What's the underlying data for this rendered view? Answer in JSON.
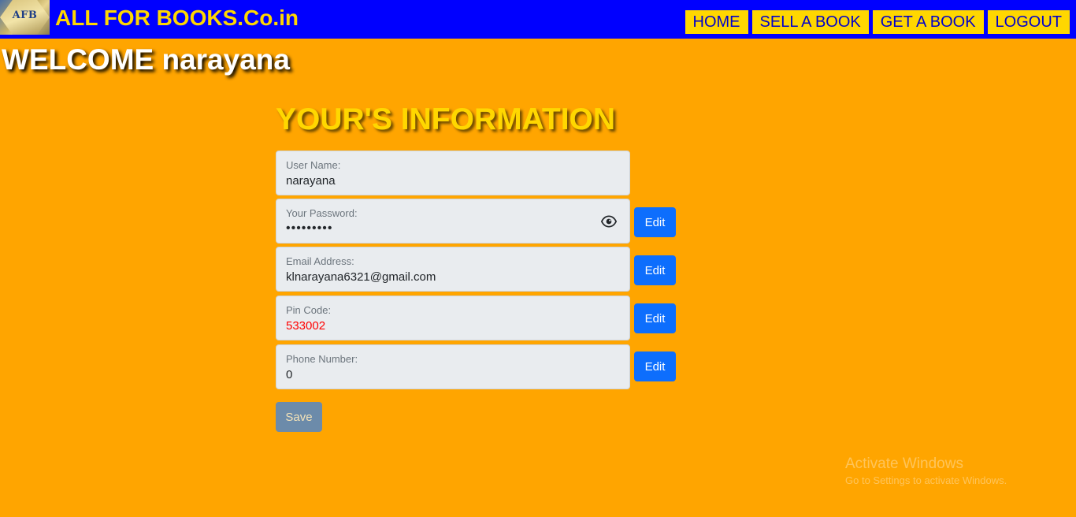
{
  "header": {
    "logo_text": "AFB",
    "brand": "ALL FOR BOOKS.Co.in",
    "nav": [
      "HOME",
      "SELL A BOOK",
      "GET A BOOK",
      "LOGOUT"
    ]
  },
  "welcome": "WELCOME narayana",
  "section_title": "YOUR'S INFORMATION",
  "fields": {
    "username": {
      "label": "User Name:",
      "value": "narayana"
    },
    "password": {
      "label": "Your Password:",
      "value": "•••••••••"
    },
    "email": {
      "label": "Email Address:",
      "value": "klnarayana6321@gmail.com"
    },
    "pincode": {
      "label": "Pin Code:",
      "value": "533002"
    },
    "phone": {
      "label": "Phone Number:",
      "value": "0"
    }
  },
  "edit_label": "Edit",
  "save_label": "Save",
  "watermark": {
    "title": "Activate Windows",
    "subtitle": "Go to Settings to activate Windows."
  },
  "colors": {
    "background": "#FFA500",
    "header": "#0000FF",
    "accent": "#FFD700",
    "edit_button": "#0d6efd",
    "pincode_text": "#FF0000"
  }
}
